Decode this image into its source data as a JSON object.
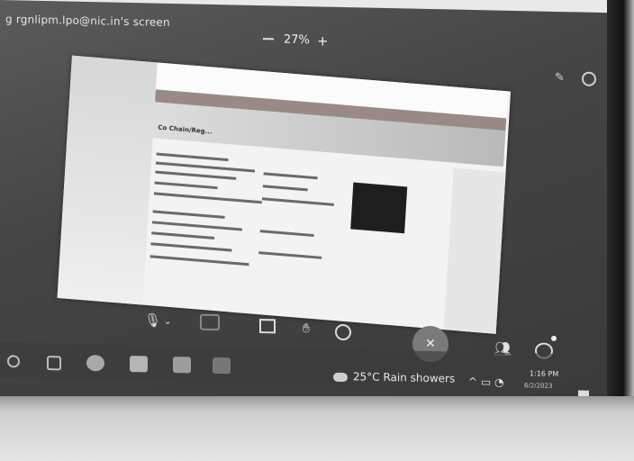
{
  "meeting": {
    "share_title": "g rgnlipm.lpo@nic.in's screen",
    "zoom_level": "27%",
    "zoom_plus": "+"
  },
  "shared_page": {
    "heading": "Co Chain/Reg..."
  },
  "taskbar": {
    "weather": "25°C Rain showers",
    "clock_time": "1:16 PM",
    "clock_date": "6/2/2023"
  },
  "icons": [
    "mic-icon",
    "video-icon",
    "share-screen-icon",
    "raise-hand-icon",
    "reactions-icon",
    "end-call-icon",
    "participants-icon",
    "chat-icon",
    "search-icon",
    "task-view-icon",
    "edge-icon",
    "explorer-icon",
    "store-icon",
    "weather-icon",
    "wifi-icon",
    "notification-icon"
  ]
}
